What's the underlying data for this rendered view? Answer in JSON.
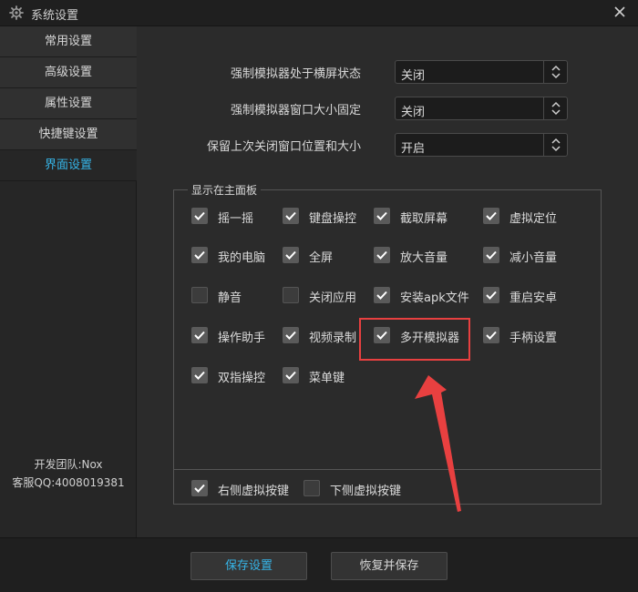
{
  "window": {
    "title": "系统设置",
    "gear_icon": "gear-icon",
    "close_icon": "close-icon"
  },
  "sidebar": {
    "items": [
      {
        "label": "常用设置",
        "active": false
      },
      {
        "label": "高级设置",
        "active": false
      },
      {
        "label": "属性设置",
        "active": false
      },
      {
        "label": "快捷键设置",
        "active": false
      },
      {
        "label": "界面设置",
        "active": true
      }
    ],
    "credit_team": "开发团队:Nox",
    "credit_qq": "客服QQ:4008019381"
  },
  "settings": [
    {
      "label": "强制模拟器处于横屏状态",
      "value": "关闭"
    },
    {
      "label": "强制模拟器窗口大小固定",
      "value": "关闭"
    },
    {
      "label": "保留上次关闭窗口位置和大小",
      "value": "开启"
    }
  ],
  "panel": {
    "legend": "显示在主面板",
    "checkboxes": [
      {
        "label": "摇一摇",
        "checked": true
      },
      {
        "label": "键盘操控",
        "checked": true
      },
      {
        "label": "截取屏幕",
        "checked": true
      },
      {
        "label": "虚拟定位",
        "checked": true
      },
      {
        "label": "我的电脑",
        "checked": true
      },
      {
        "label": "全屏",
        "checked": true
      },
      {
        "label": "放大音量",
        "checked": true
      },
      {
        "label": "减小音量",
        "checked": true
      },
      {
        "label": "静音",
        "checked": false
      },
      {
        "label": "关闭应用",
        "checked": false
      },
      {
        "label": "安装apk文件",
        "checked": true
      },
      {
        "label": "重启安卓",
        "checked": true
      },
      {
        "label": "操作助手",
        "checked": true
      },
      {
        "label": "视频录制",
        "checked": true
      },
      {
        "label": "多开模拟器",
        "checked": true
      },
      {
        "label": "手柄设置",
        "checked": true
      },
      {
        "label": "双指操控",
        "checked": true
      },
      {
        "label": "菜单键",
        "checked": true
      }
    ],
    "bottom_checkboxes": [
      {
        "label": "右侧虚拟按键",
        "checked": true
      },
      {
        "label": "下侧虚拟按键",
        "checked": false
      }
    ]
  },
  "footer": {
    "save_label": "保存设置",
    "restore_label": "恢复并保存"
  },
  "colors": {
    "accent": "#36b5e8",
    "highlight": "#e84040"
  }
}
